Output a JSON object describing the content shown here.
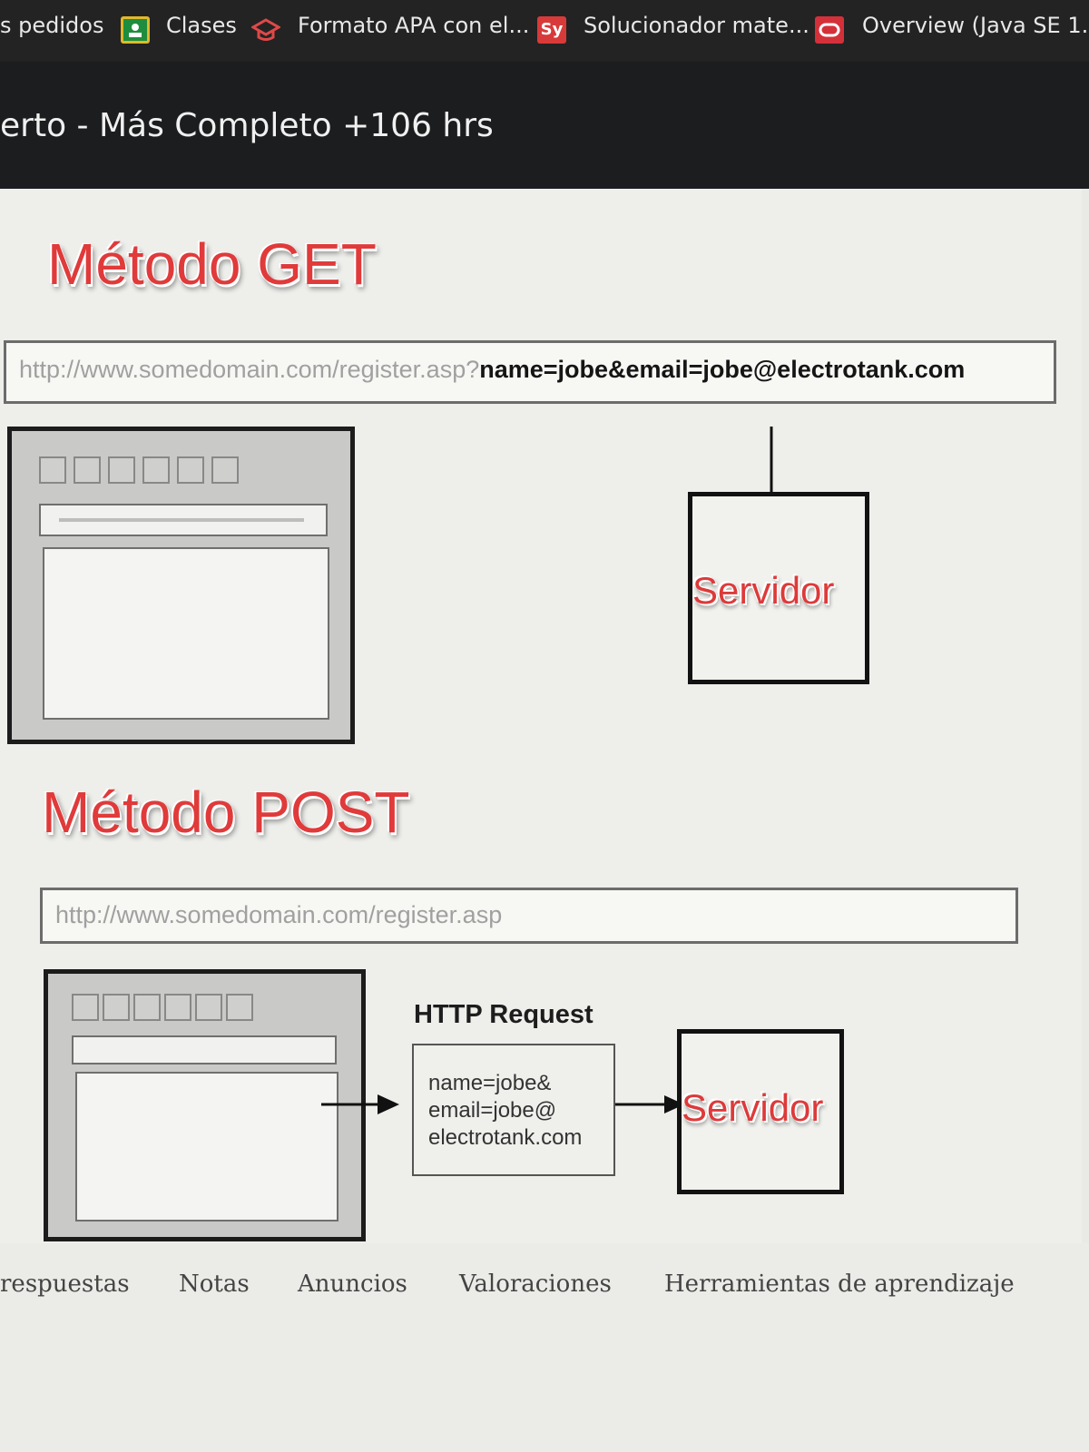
{
  "bookmarks": [
    {
      "label": "s pedidos",
      "icon": ""
    },
    {
      "label": "Clases",
      "icon": "google-classroom-icon"
    },
    {
      "label": "Formato APA con el...",
      "icon": "graduation-cap-icon"
    },
    {
      "label": "Solucionador mate...",
      "icon": "symbolab-icon",
      "icon_text": "Sy"
    },
    {
      "label": "Overview (Java SE 1...",
      "icon": "oracle-icon"
    }
  ],
  "course": {
    "title": "erto - Más Completo +106 hrs"
  },
  "slide": {
    "get": {
      "heading": "Método GET",
      "url_base": "http://www.somedomain.com/register.asp?",
      "url_query": "name=jobe&email=jobe@electrotank.com",
      "server_label": "Servidor"
    },
    "post": {
      "heading": "Método POST",
      "url": "http://www.somedomain.com/register.asp",
      "request_title": "HTTP Request",
      "request_lines": [
        "name=jobe&",
        "email=jobe@",
        "electrotank.com"
      ],
      "server_label": "Servidor"
    }
  },
  "tabs": [
    "respuestas",
    "Notas",
    "Anuncios",
    "Valoraciones",
    "Herramientas de aprendizaje"
  ],
  "colors": {
    "heading_red": "#e03a3a",
    "topbar": "#232323",
    "symbolab_red": "#d83a3a",
    "oracle_red": "#d4303a",
    "classroom_green": "#1e8e3e"
  }
}
